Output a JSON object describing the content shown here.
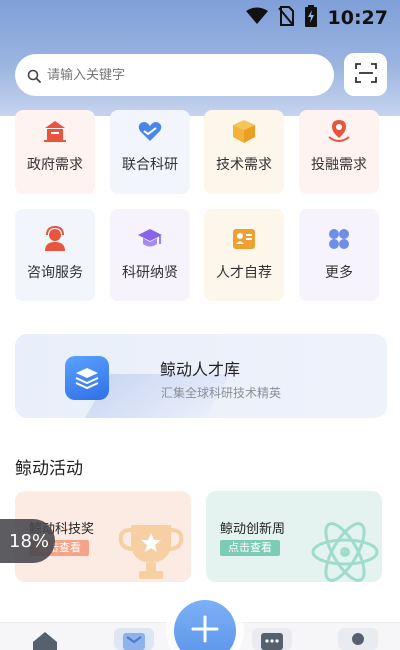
{
  "status_bar": {
    "time": "10:27",
    "icons": [
      "wifi-icon",
      "no-sim-icon",
      "battery-charging-icon"
    ]
  },
  "search": {
    "placeholder": "请输入关键字"
  },
  "grid": [
    {
      "label": "政府需求",
      "icon": "government-building-icon",
      "bg": "#fff3f1",
      "color": "#e8553f"
    },
    {
      "label": "联合科研",
      "icon": "handshake-heart-icon",
      "bg": "#f3f5fc",
      "color": "#4a86e8"
    },
    {
      "label": "技术需求",
      "icon": "cube-box-icon",
      "bg": "#fdf6ea",
      "color": "#f4b23c"
    },
    {
      "label": "投融需求",
      "icon": "finance-pin-icon",
      "bg": "#fff3f1",
      "color": "#e8553f"
    },
    {
      "label": "咨询服务",
      "icon": "headset-user-icon",
      "bg": "#f3f5fc",
      "color": "#e8553f"
    },
    {
      "label": "科研纳贤",
      "icon": "graduation-cap-icon",
      "bg": "#f6f3fd",
      "color": "#8a64e8"
    },
    {
      "label": "人才自荐",
      "icon": "id-card-icon",
      "bg": "#fdf6ea",
      "color": "#f0a030"
    },
    {
      "label": "更多",
      "icon": "four-petal-more-icon",
      "bg": "#f6f3fd",
      "color": "#6f8fe6"
    }
  ],
  "banner": {
    "title": "鲸动人才库",
    "subtitle": "汇集全球科研技术精英",
    "icon": "stack-layers-icon"
  },
  "activity": {
    "section_title": "鲸动活动",
    "cards": [
      {
        "title": "鲸动科技奖",
        "button": "点击查看",
        "icon": "trophy-icon",
        "bg": "#fbebe3",
        "accent": "#f4a589"
      },
      {
        "title": "鲸动创新周",
        "button": "点击查看",
        "icon": "atom-icon",
        "bg": "#e4f3ef",
        "accent": "#7ccbb5"
      }
    ]
  },
  "floating_progress": {
    "value": 18,
    "text": "18%"
  },
  "tabbar": {
    "icons": [
      "home-icon",
      "message-icon",
      "add-icon",
      "chat-icon",
      "profile-icon"
    ]
  }
}
